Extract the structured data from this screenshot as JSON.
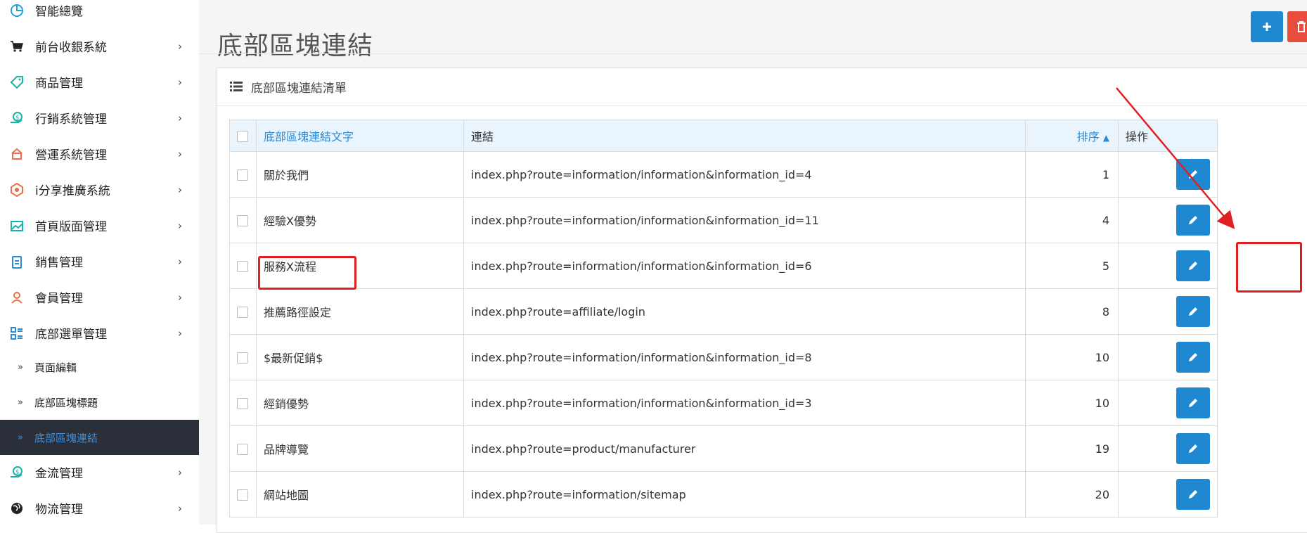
{
  "sidebar": {
    "items": [
      {
        "label": "智能總覽",
        "icon": "pie-chart-icon",
        "has_children": false
      },
      {
        "label": "前台收銀系統",
        "icon": "cart-icon",
        "has_children": true
      },
      {
        "label": "商品管理",
        "icon": "tag-icon",
        "has_children": true
      },
      {
        "label": "行銷系統管理",
        "icon": "money-hand-icon",
        "has_children": true
      },
      {
        "label": "營運系統管理",
        "icon": "store-icon",
        "has_children": true
      },
      {
        "label": "i分享推廣系統",
        "icon": "share-badge-icon",
        "has_children": true
      },
      {
        "label": "首頁版面管理",
        "icon": "image-icon",
        "has_children": true
      },
      {
        "label": "銷售管理",
        "icon": "clipboard-icon",
        "has_children": true
      },
      {
        "label": "會員管理",
        "icon": "user-icon",
        "has_children": true
      },
      {
        "label": "底部選單管理",
        "icon": "grid-list-icon",
        "has_children": true
      }
    ],
    "sub_items": [
      {
        "label": "頁面編輯"
      },
      {
        "label": "底部區塊標題"
      },
      {
        "label": "底部區塊連結",
        "active": true
      }
    ],
    "items_after": [
      {
        "label": "金流管理",
        "icon": "money-hand-icon",
        "has_children": true
      },
      {
        "label": "物流管理",
        "icon": "globe-icon",
        "has_children": true
      }
    ],
    "chevron": "›",
    "sub_chevron": "»"
  },
  "header": {
    "title": "底部區塊連結",
    "add_icon": "plus-icon",
    "delete_icon": "trash-icon"
  },
  "panel": {
    "title": "底部區塊連結清單",
    "icon": "list-icon"
  },
  "table": {
    "columns": [
      "底部區塊連結文字",
      "連結",
      "排序",
      "操作"
    ],
    "sort_indicator": "^",
    "rows": [
      {
        "text": "關於我們",
        "link": "index.php?route=information/information&information_id=4",
        "sort": "1"
      },
      {
        "text": "經驗X優勢",
        "link": "index.php?route=information/information&information_id=11",
        "sort": "4"
      },
      {
        "text": "服務X流程",
        "link": "index.php?route=information/information&information_id=6",
        "sort": "5"
      },
      {
        "text": "推薦路徑設定",
        "link": "index.php?route=affiliate/login",
        "sort": "8"
      },
      {
        "text": "$最新促銷$",
        "link": "index.php?route=information/information&information_id=8",
        "sort": "10"
      },
      {
        "text": "經銷優勢",
        "link": "index.php?route=information/information&information_id=3",
        "sort": "10"
      },
      {
        "text": "品牌導覽",
        "link": "index.php?route=product/manufacturer",
        "sort": "19"
      },
      {
        "text": "網站地圖",
        "link": "index.php?route=information/sitemap",
        "sort": "20"
      }
    ],
    "edit_icon": "pencil-icon"
  },
  "colors": {
    "accent": "#1e88d0",
    "danger": "#e74c3c",
    "annotation": "#e02020",
    "sidebar_active_bg": "#2a2f3a"
  }
}
